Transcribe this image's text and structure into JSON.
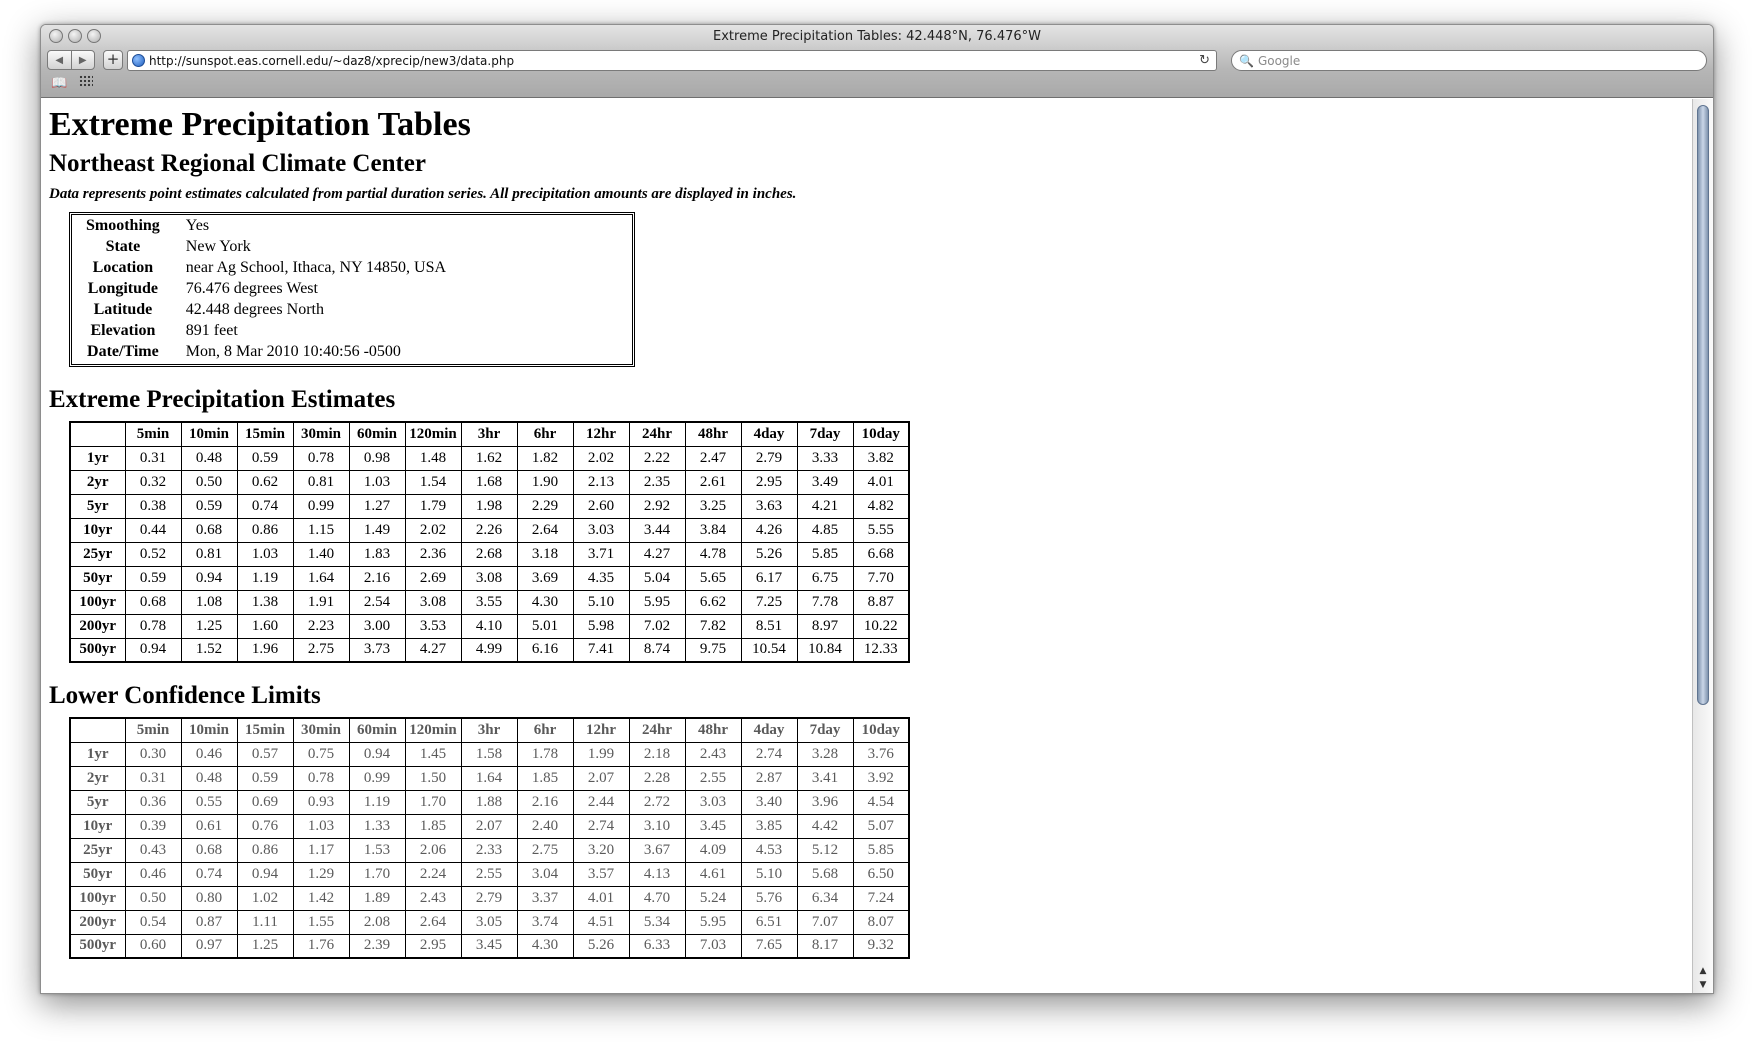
{
  "window": {
    "title": "Extreme Precipitation Tables: 42.448°N, 76.476°W",
    "url": "http://sunspot.eas.cornell.edu/~daz8/xprecip/new3/data.php",
    "search_placeholder": "Google",
    "back_glyph": "◀",
    "forward_glyph": "▶",
    "add_glyph": "+",
    "reload_glyph": "↻",
    "search_glyph": "🔍",
    "bookmarks_glyph": "📖",
    "scroll_up_glyph": "▲",
    "scroll_down_glyph": "▼"
  },
  "page": {
    "title": "Extreme Precipitation Tables",
    "subtitle": "Northeast Regional Climate Center",
    "note": "Data represents point estimates calculated from partial duration series. All precipitation amounts are displayed in inches."
  },
  "info": [
    {
      "label": "Smoothing",
      "value": "Yes"
    },
    {
      "label": "State",
      "value": "New York"
    },
    {
      "label": "Location",
      "value": "near Ag School, Ithaca, NY 14850, USA"
    },
    {
      "label": "Longitude",
      "value": "76.476 degrees West"
    },
    {
      "label": "Latitude",
      "value": "42.448 degrees North"
    },
    {
      "label": "Elevation",
      "value": "891 feet"
    },
    {
      "label": "Date/Time",
      "value": "Mon, 8 Mar 2010 10:40:56 -0500"
    }
  ],
  "columns": [
    "5min",
    "10min",
    "15min",
    "30min",
    "60min",
    "120min",
    "3hr",
    "6hr",
    "12hr",
    "24hr",
    "48hr",
    "4day",
    "7day",
    "10day"
  ],
  "estimates": {
    "title": "Extreme Precipitation Estimates",
    "rows": [
      {
        "label": "1yr",
        "values": [
          "0.31",
          "0.48",
          "0.59",
          "0.78",
          "0.98",
          "1.48",
          "1.62",
          "1.82",
          "2.02",
          "2.22",
          "2.47",
          "2.79",
          "3.33",
          "3.82"
        ]
      },
      {
        "label": "2yr",
        "values": [
          "0.32",
          "0.50",
          "0.62",
          "0.81",
          "1.03",
          "1.54",
          "1.68",
          "1.90",
          "2.13",
          "2.35",
          "2.61",
          "2.95",
          "3.49",
          "4.01"
        ]
      },
      {
        "label": "5yr",
        "values": [
          "0.38",
          "0.59",
          "0.74",
          "0.99",
          "1.27",
          "1.79",
          "1.98",
          "2.29",
          "2.60",
          "2.92",
          "3.25",
          "3.63",
          "4.21",
          "4.82"
        ]
      },
      {
        "label": "10yr",
        "values": [
          "0.44",
          "0.68",
          "0.86",
          "1.15",
          "1.49",
          "2.02",
          "2.26",
          "2.64",
          "3.03",
          "3.44",
          "3.84",
          "4.26",
          "4.85",
          "5.55"
        ]
      },
      {
        "label": "25yr",
        "values": [
          "0.52",
          "0.81",
          "1.03",
          "1.40",
          "1.83",
          "2.36",
          "2.68",
          "3.18",
          "3.71",
          "4.27",
          "4.78",
          "5.26",
          "5.85",
          "6.68"
        ]
      },
      {
        "label": "50yr",
        "values": [
          "0.59",
          "0.94",
          "1.19",
          "1.64",
          "2.16",
          "2.69",
          "3.08",
          "3.69",
          "4.35",
          "5.04",
          "5.65",
          "6.17",
          "6.75",
          "7.70"
        ]
      },
      {
        "label": "100yr",
        "values": [
          "0.68",
          "1.08",
          "1.38",
          "1.91",
          "2.54",
          "3.08",
          "3.55",
          "4.30",
          "5.10",
          "5.95",
          "6.62",
          "7.25",
          "7.78",
          "8.87"
        ]
      },
      {
        "label": "200yr",
        "values": [
          "0.78",
          "1.25",
          "1.60",
          "2.23",
          "3.00",
          "3.53",
          "4.10",
          "5.01",
          "5.98",
          "7.02",
          "7.82",
          "8.51",
          "8.97",
          "10.22"
        ]
      },
      {
        "label": "500yr",
        "values": [
          "0.94",
          "1.52",
          "1.96",
          "2.75",
          "3.73",
          "4.27",
          "4.99",
          "6.16",
          "7.41",
          "8.74",
          "9.75",
          "10.54",
          "10.84",
          "12.33"
        ]
      }
    ]
  },
  "lower": {
    "title": "Lower Confidence Limits",
    "rows": [
      {
        "label": "1yr",
        "values": [
          "0.30",
          "0.46",
          "0.57",
          "0.75",
          "0.94",
          "1.45",
          "1.58",
          "1.78",
          "1.99",
          "2.18",
          "2.43",
          "2.74",
          "3.28",
          "3.76"
        ]
      },
      {
        "label": "2yr",
        "values": [
          "0.31",
          "0.48",
          "0.59",
          "0.78",
          "0.99",
          "1.50",
          "1.64",
          "1.85",
          "2.07",
          "2.28",
          "2.55",
          "2.87",
          "3.41",
          "3.92"
        ]
      },
      {
        "label": "5yr",
        "values": [
          "0.36",
          "0.55",
          "0.69",
          "0.93",
          "1.19",
          "1.70",
          "1.88",
          "2.16",
          "2.44",
          "2.72",
          "3.03",
          "3.40",
          "3.96",
          "4.54"
        ]
      },
      {
        "label": "10yr",
        "values": [
          "0.39",
          "0.61",
          "0.76",
          "1.03",
          "1.33",
          "1.85",
          "2.07",
          "2.40",
          "2.74",
          "3.10",
          "3.45",
          "3.85",
          "4.42",
          "5.07"
        ]
      },
      {
        "label": "25yr",
        "values": [
          "0.43",
          "0.68",
          "0.86",
          "1.17",
          "1.53",
          "2.06",
          "2.33",
          "2.75",
          "3.20",
          "3.67",
          "4.09",
          "4.53",
          "5.12",
          "5.85"
        ]
      },
      {
        "label": "50yr",
        "values": [
          "0.46",
          "0.74",
          "0.94",
          "1.29",
          "1.70",
          "2.24",
          "2.55",
          "3.04",
          "3.57",
          "4.13",
          "4.61",
          "5.10",
          "5.68",
          "6.50"
        ]
      },
      {
        "label": "100yr",
        "values": [
          "0.50",
          "0.80",
          "1.02",
          "1.42",
          "1.89",
          "2.43",
          "2.79",
          "3.37",
          "4.01",
          "4.70",
          "5.24",
          "5.76",
          "6.34",
          "7.24"
        ]
      },
      {
        "label": "200yr",
        "values": [
          "0.54",
          "0.87",
          "1.11",
          "1.55",
          "2.08",
          "2.64",
          "3.05",
          "3.74",
          "4.51",
          "5.34",
          "5.95",
          "6.51",
          "7.07",
          "8.07"
        ]
      },
      {
        "label": "500yr",
        "values": [
          "0.60",
          "0.97",
          "1.25",
          "1.76",
          "2.39",
          "2.95",
          "3.45",
          "4.30",
          "5.26",
          "6.33",
          "7.03",
          "7.65",
          "8.17",
          "9.32"
        ]
      }
    ]
  }
}
